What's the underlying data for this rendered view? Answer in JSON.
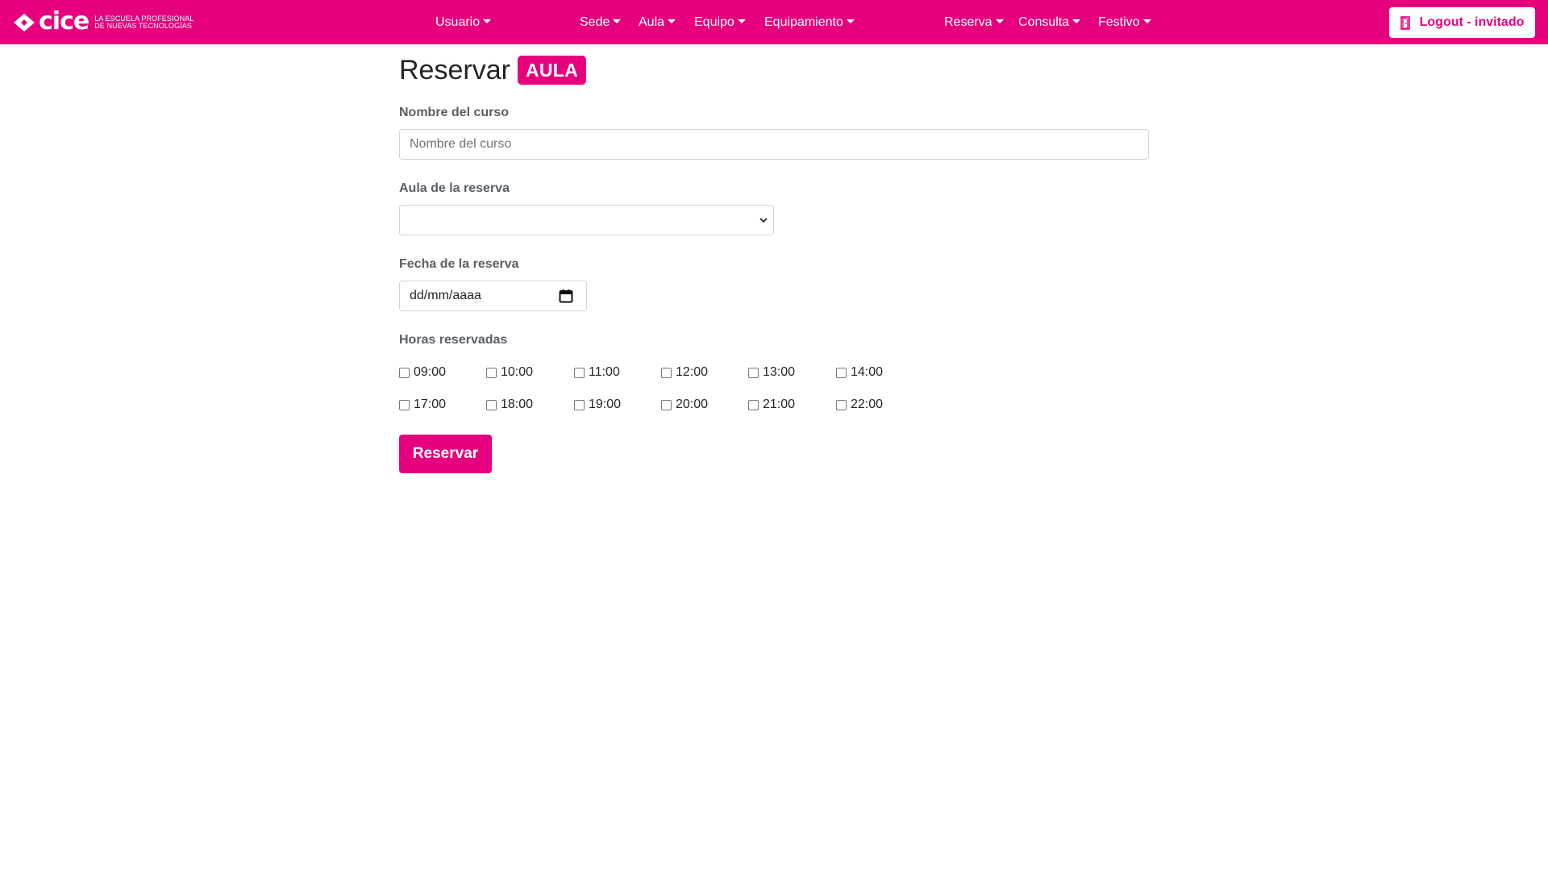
{
  "navbar": {
    "brand": {
      "word": "cice",
      "tagline_line1": "LA ESCUELA PROFESIONAL",
      "tagline_line2": "DE NUEVAS TECNOLOGÍAS",
      "logo_icon": "cice-logo-icon"
    },
    "items": [
      {
        "label": "Usuario"
      },
      {
        "label": "Sede"
      },
      {
        "label": "Aula"
      },
      {
        "label": "Equipo"
      },
      {
        "label": "Equipamiento"
      },
      {
        "label": "Reserva"
      },
      {
        "label": "Consulta"
      },
      {
        "label": "Festivo"
      }
    ],
    "logout": {
      "label": "Logout - invitado",
      "icon": "door-icon"
    }
  },
  "page": {
    "title": "Reservar",
    "badge": "AULA"
  },
  "form": {
    "course": {
      "label": "Nombre del curso",
      "placeholder": "Nombre del curso",
      "value": ""
    },
    "classroom": {
      "label": "Aula de la reserva",
      "selected": ""
    },
    "date": {
      "label": "Fecha de la reserva",
      "value": "dd/mm/aaaa",
      "icon": "calendar-icon"
    },
    "hours": {
      "label": "Horas reservadas",
      "slots": [
        {
          "time": "09:00",
          "checked": false
        },
        {
          "time": "10:00",
          "checked": false
        },
        {
          "time": "11:00",
          "checked": false
        },
        {
          "time": "12:00",
          "checked": false
        },
        {
          "time": "13:00",
          "checked": false
        },
        {
          "time": "14:00",
          "checked": false
        },
        {
          "time": "17:00",
          "checked": false
        },
        {
          "time": "18:00",
          "checked": false
        },
        {
          "time": "19:00",
          "checked": false
        },
        {
          "time": "20:00",
          "checked": false
        },
        {
          "time": "21:00",
          "checked": false
        },
        {
          "time": "22:00",
          "checked": false
        }
      ]
    },
    "submit_label": "Reservar"
  },
  "colors": {
    "brand": "#e6007e",
    "label": "#5a5f66",
    "border": "#ced4da"
  }
}
